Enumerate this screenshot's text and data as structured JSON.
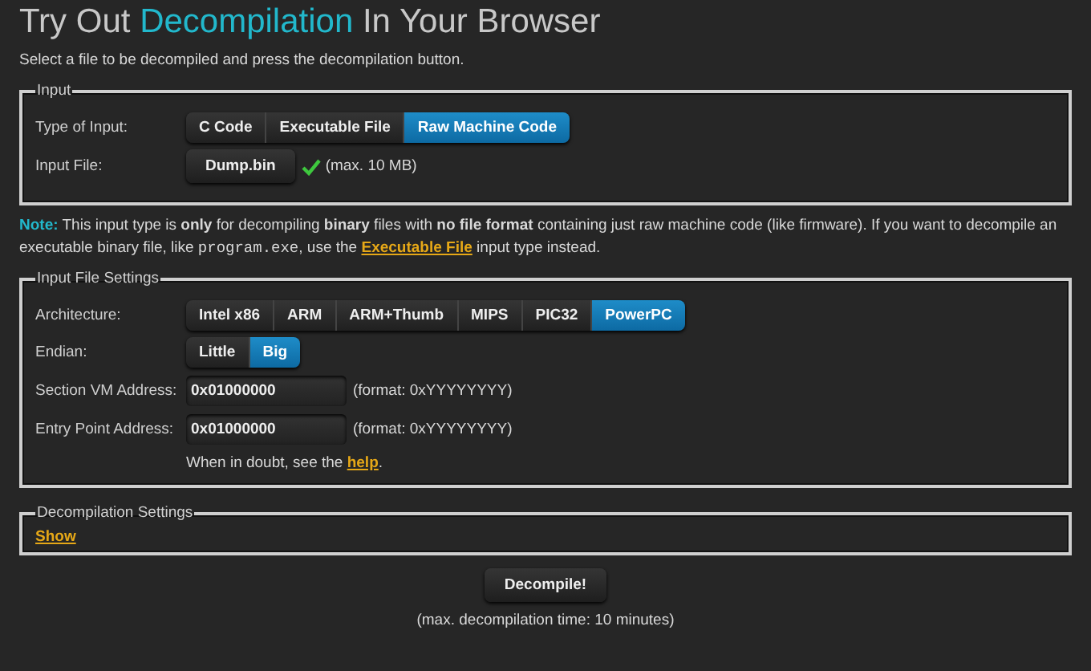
{
  "title": {
    "before": "Try Out ",
    "highlight": "Decompilation",
    "after": " In Your Browser"
  },
  "intro": "Select a file to be decompiled and press the decompilation button.",
  "input": {
    "legend": "Input",
    "type_label": "Type of Input:",
    "types": [
      {
        "label": "C Code",
        "selected": false
      },
      {
        "label": "Executable File",
        "selected": false
      },
      {
        "label": "Raw Machine Code",
        "selected": true
      }
    ],
    "file_label": "Input File:",
    "file_button": "Dump.bin",
    "file_ok": true,
    "file_note": "(max. 10 MB)"
  },
  "note": [
    {
      "kind": "label",
      "text": "Note:"
    },
    {
      "kind": "text",
      "text": " This input type is "
    },
    {
      "kind": "bold",
      "text": "only"
    },
    {
      "kind": "text",
      "text": " for decompiling "
    },
    {
      "kind": "bold",
      "text": "binary"
    },
    {
      "kind": "text",
      "text": " files with "
    },
    {
      "kind": "bold",
      "text": "no file format"
    },
    {
      "kind": "text",
      "text": " containing just raw machine code (like firmware). If you want to decompile an executable binary file, like "
    },
    {
      "kind": "code",
      "text": "program.exe"
    },
    {
      "kind": "text",
      "text": ", use the "
    },
    {
      "kind": "link",
      "text": "Executable File"
    },
    {
      "kind": "text",
      "text": " input type instead."
    }
  ],
  "settings": {
    "legend": "Input File Settings",
    "arch_label": "Architecture:",
    "architectures": [
      {
        "label": "Intel x86",
        "selected": false
      },
      {
        "label": "ARM",
        "selected": false
      },
      {
        "label": "ARM+Thumb",
        "selected": false
      },
      {
        "label": "MIPS",
        "selected": false
      },
      {
        "label": "PIC32",
        "selected": false
      },
      {
        "label": "PowerPC",
        "selected": true
      }
    ],
    "endian_label": "Endian:",
    "endians": [
      {
        "label": "Little",
        "selected": false
      },
      {
        "label": "Big",
        "selected": true
      }
    ],
    "fields": [
      {
        "label": "Section VM Address:",
        "value": "0x01000000",
        "hint": "(format: 0xYYYYYYYY)"
      },
      {
        "label": "Entry Point Address:",
        "value": "0x01000000",
        "hint": "(format: 0xYYYYYYYY)"
      }
    ],
    "help_text": "When in doubt, see the ",
    "help_link": "help",
    "help_end": "."
  },
  "decompilation_settings": {
    "legend": "Decompilation Settings",
    "link": "Show"
  },
  "decompile_button": "Decompile!",
  "time_note": "(max. decompilation time: 10 minutes)"
}
